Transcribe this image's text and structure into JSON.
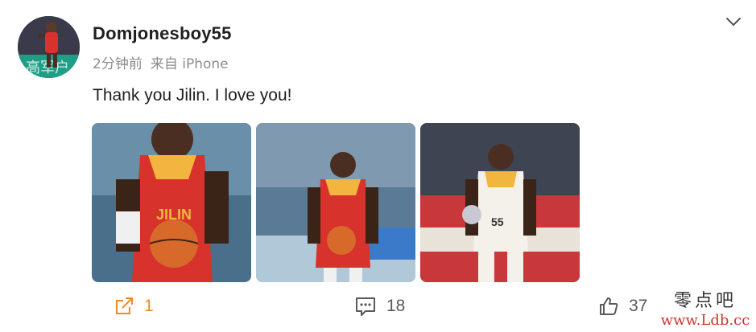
{
  "post": {
    "username": "Domjonesboy55",
    "time": "2分钟前",
    "source": "来自 iPhone",
    "text": "Thank you Jilin. I love you!",
    "images": [
      {
        "description": "player in red Jilin jersey holding basketball, close-up"
      },
      {
        "description": "player in red Jilin jersey at free throw line"
      },
      {
        "description": "player in white jersey holding trophy"
      }
    ]
  },
  "actions": {
    "share_count": "1",
    "comment_count": "18",
    "like_count": "37"
  },
  "watermark": {
    "line1": "零点吧",
    "line2": "www.Ldb.cc"
  },
  "colors": {
    "accent_orange": "#f08a24",
    "text_primary": "#1f1f1f",
    "text_secondary": "#8c8c8c"
  }
}
